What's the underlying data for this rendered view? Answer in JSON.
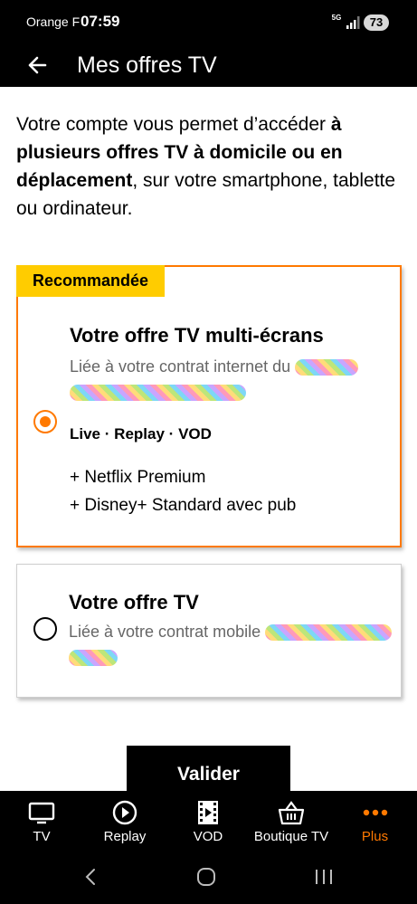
{
  "status_bar": {
    "carrier": "Orange F",
    "time": "07:59",
    "network": "5G",
    "battery": "73"
  },
  "header": {
    "title": "Mes offres TV"
  },
  "intro": {
    "part1": "Votre compte vous permet d’accéder ",
    "bold1": "à plusieurs offres TV à domicile ou en déplacement",
    "part2": ", sur votre smartphone, tablette ou ordinateur."
  },
  "offers": [
    {
      "badge": "Recommandée",
      "title": "Votre offre TV multi-écrans",
      "description": "Liée à votre contrat internet du",
      "services": [
        "Live",
        "Replay",
        "VOD"
      ],
      "separator": "·",
      "extras": [
        "+ Netflix Premium",
        "+ Disney+ Standard avec pub"
      ],
      "selected": true
    },
    {
      "title": "Votre offre TV",
      "description": "Liée à votre contrat mobile",
      "selected": false
    }
  ],
  "validate_label": "Valider",
  "bottom_nav": [
    {
      "label": "TV",
      "icon": "tv-icon"
    },
    {
      "label": "Replay",
      "icon": "replay-play-icon"
    },
    {
      "label": "VOD",
      "icon": "film-icon"
    },
    {
      "label": "Boutique TV",
      "icon": "basket-icon"
    },
    {
      "label": "Plus",
      "icon": "more-dots-icon",
      "active": true
    }
  ],
  "colors": {
    "accent": "#ff7900",
    "badge": "#ffcc00",
    "bar": "#000000"
  }
}
